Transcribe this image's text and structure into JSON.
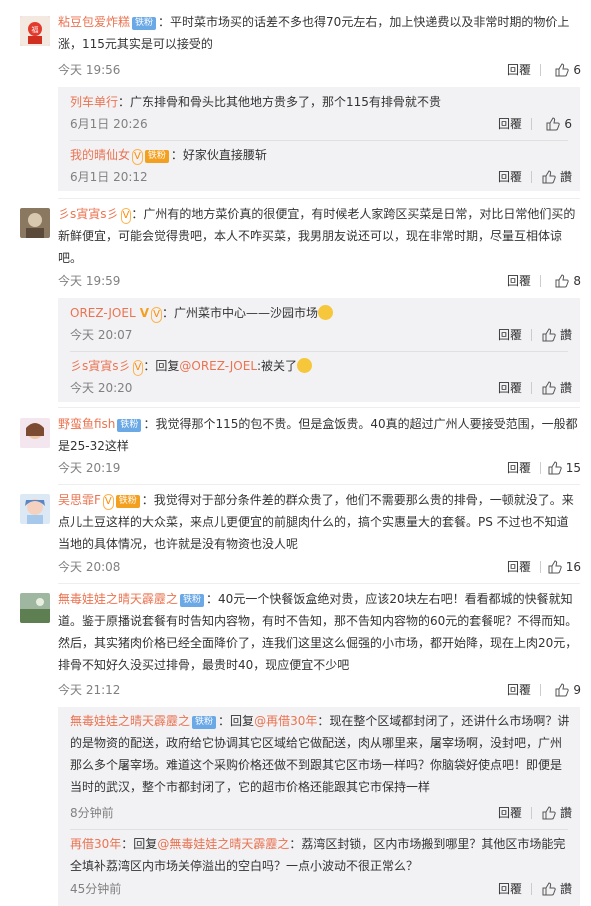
{
  "thumb_icon": "thumbs-up-icon",
  "comments": [
    {
      "user": "粘豆包爱炸糕",
      "badge": "铁粉",
      "sep": "：",
      "text": "平时菜市场买的话差不多也得70元左右，加上快递费以及非常时期的物价上涨，115元其实是可以接受的",
      "time": "今天 19:56",
      "reply": "回覆",
      "likes": "6",
      "replies": [
        {
          "user": "列车单行",
          "sep": "：",
          "text": "广东排骨和骨头比其他地方贵多了，那个115有排骨就不贵",
          "time": "6月1日 20:26",
          "reply": "回覆",
          "likes": "6"
        },
        {
          "user": "我的晴仙女",
          "badge": "铁粉",
          "sep": "：",
          "text": "好家伙直接腰斩",
          "time": "6月1日 20:12",
          "reply": "回覆",
          "likes": "讚"
        }
      ]
    },
    {
      "user": "彡s寊寊s彡",
      "sep": "：",
      "text": "广州有的地方菜价真的很便宜，有时候老人家跨区买菜是日常，对比日常他们买的新鲜便宜，可能会觉得贵吧，本人不咋买菜，我男朋友说还可以，现在非常时期，尽量互相体谅吧。",
      "time": "今天 19:59",
      "reply": "回覆",
      "likes": "8",
      "replies": [
        {
          "user": "OREZ-JOEL",
          "sep": "：",
          "text": "广州菜市中心——沙园市场",
          "time": "今天 20:07",
          "reply": "回覆",
          "likes": "讚"
        },
        {
          "user": "彡s寊寊s彡",
          "sep": "：",
          "prefix": "回复",
          "mention": "@OREZ-JOEL",
          "text": ":被关了",
          "time": "今天 20:20",
          "reply": "回覆",
          "likes": "讚"
        }
      ]
    },
    {
      "user": "野蛮鱼fish",
      "badge": "铁粉",
      "sep": "：",
      "text": "我觉得那个115的包不贵。但是盒饭贵。40真的超过广州人要接受范围，一般都是25-32这样",
      "time": "今天 20:19",
      "reply": "回覆",
      "likes": "15"
    },
    {
      "user": "吴思霏F",
      "badge": "铁粉",
      "sep": "：",
      "text": "我觉得对于部分条件差的群众贵了，他们不需要那么贵的排骨，一顿就没了。来点儿土豆这样的大众菜，来点儿更便宜的前腿肉什么的，搞个实惠量大的套餐。PS 不过也不知道当地的具体情况，也许就是没有物资也没人呢",
      "time": "今天 20:08",
      "reply": "回覆",
      "likes": "16"
    },
    {
      "user": "無毒娃娃之晴天霹靂之",
      "badge": "铁粉",
      "sep": "：",
      "text": "40元一个快餐饭盒绝对贵，应该20块左右吧！看看都城的快餐就知道。鉴于原播说套餐有时告知内容物，有时不告知，那不告知内容物的60元的套餐呢？不得而知。然后，其实猪肉价格已经全面降价了，连我们这里这么倔强的小市场，都开始降，现在上肉20元，排骨不知好久没买过排骨，最贵时40，现应便宜不少吧",
      "time": "今天 21:12",
      "reply": "回覆",
      "likes": "9",
      "replies": [
        {
          "user": "無毒娃娃之晴天霹靂之",
          "badge": "铁粉",
          "sep": "：",
          "prefix": "回复",
          "mention": "@再借30年",
          "text": "：现在整个区域都封闭了，还讲什么市场啊？讲的是物资的配送，政府给它协调其它区域给它做配送，肉从哪里来，屠宰场啊，没封吧，广州那么多个屠宰场。难道这个采购价格还做不到跟其它区市场一样吗？你脑袋好使点吧！即便是当时的武汉，整个市都封闭了，它的超市价格还能跟其它市保持一样",
          "time": "8分钟前",
          "reply": "回覆",
          "likes": "讚"
        },
        {
          "user": "再借30年",
          "sep": "：",
          "prefix": "回复",
          "mention": "@無毒娃娃之晴天霹靂之",
          "text": "：荔湾区封锁，区内市场搬到哪里？其他区市场能完全填补荔湾区内市场关停溢出的空白吗？一点小波动不很正常么？",
          "time": "45分钟前",
          "reply": "回覆",
          "likes": "讚"
        }
      ]
    }
  ]
}
